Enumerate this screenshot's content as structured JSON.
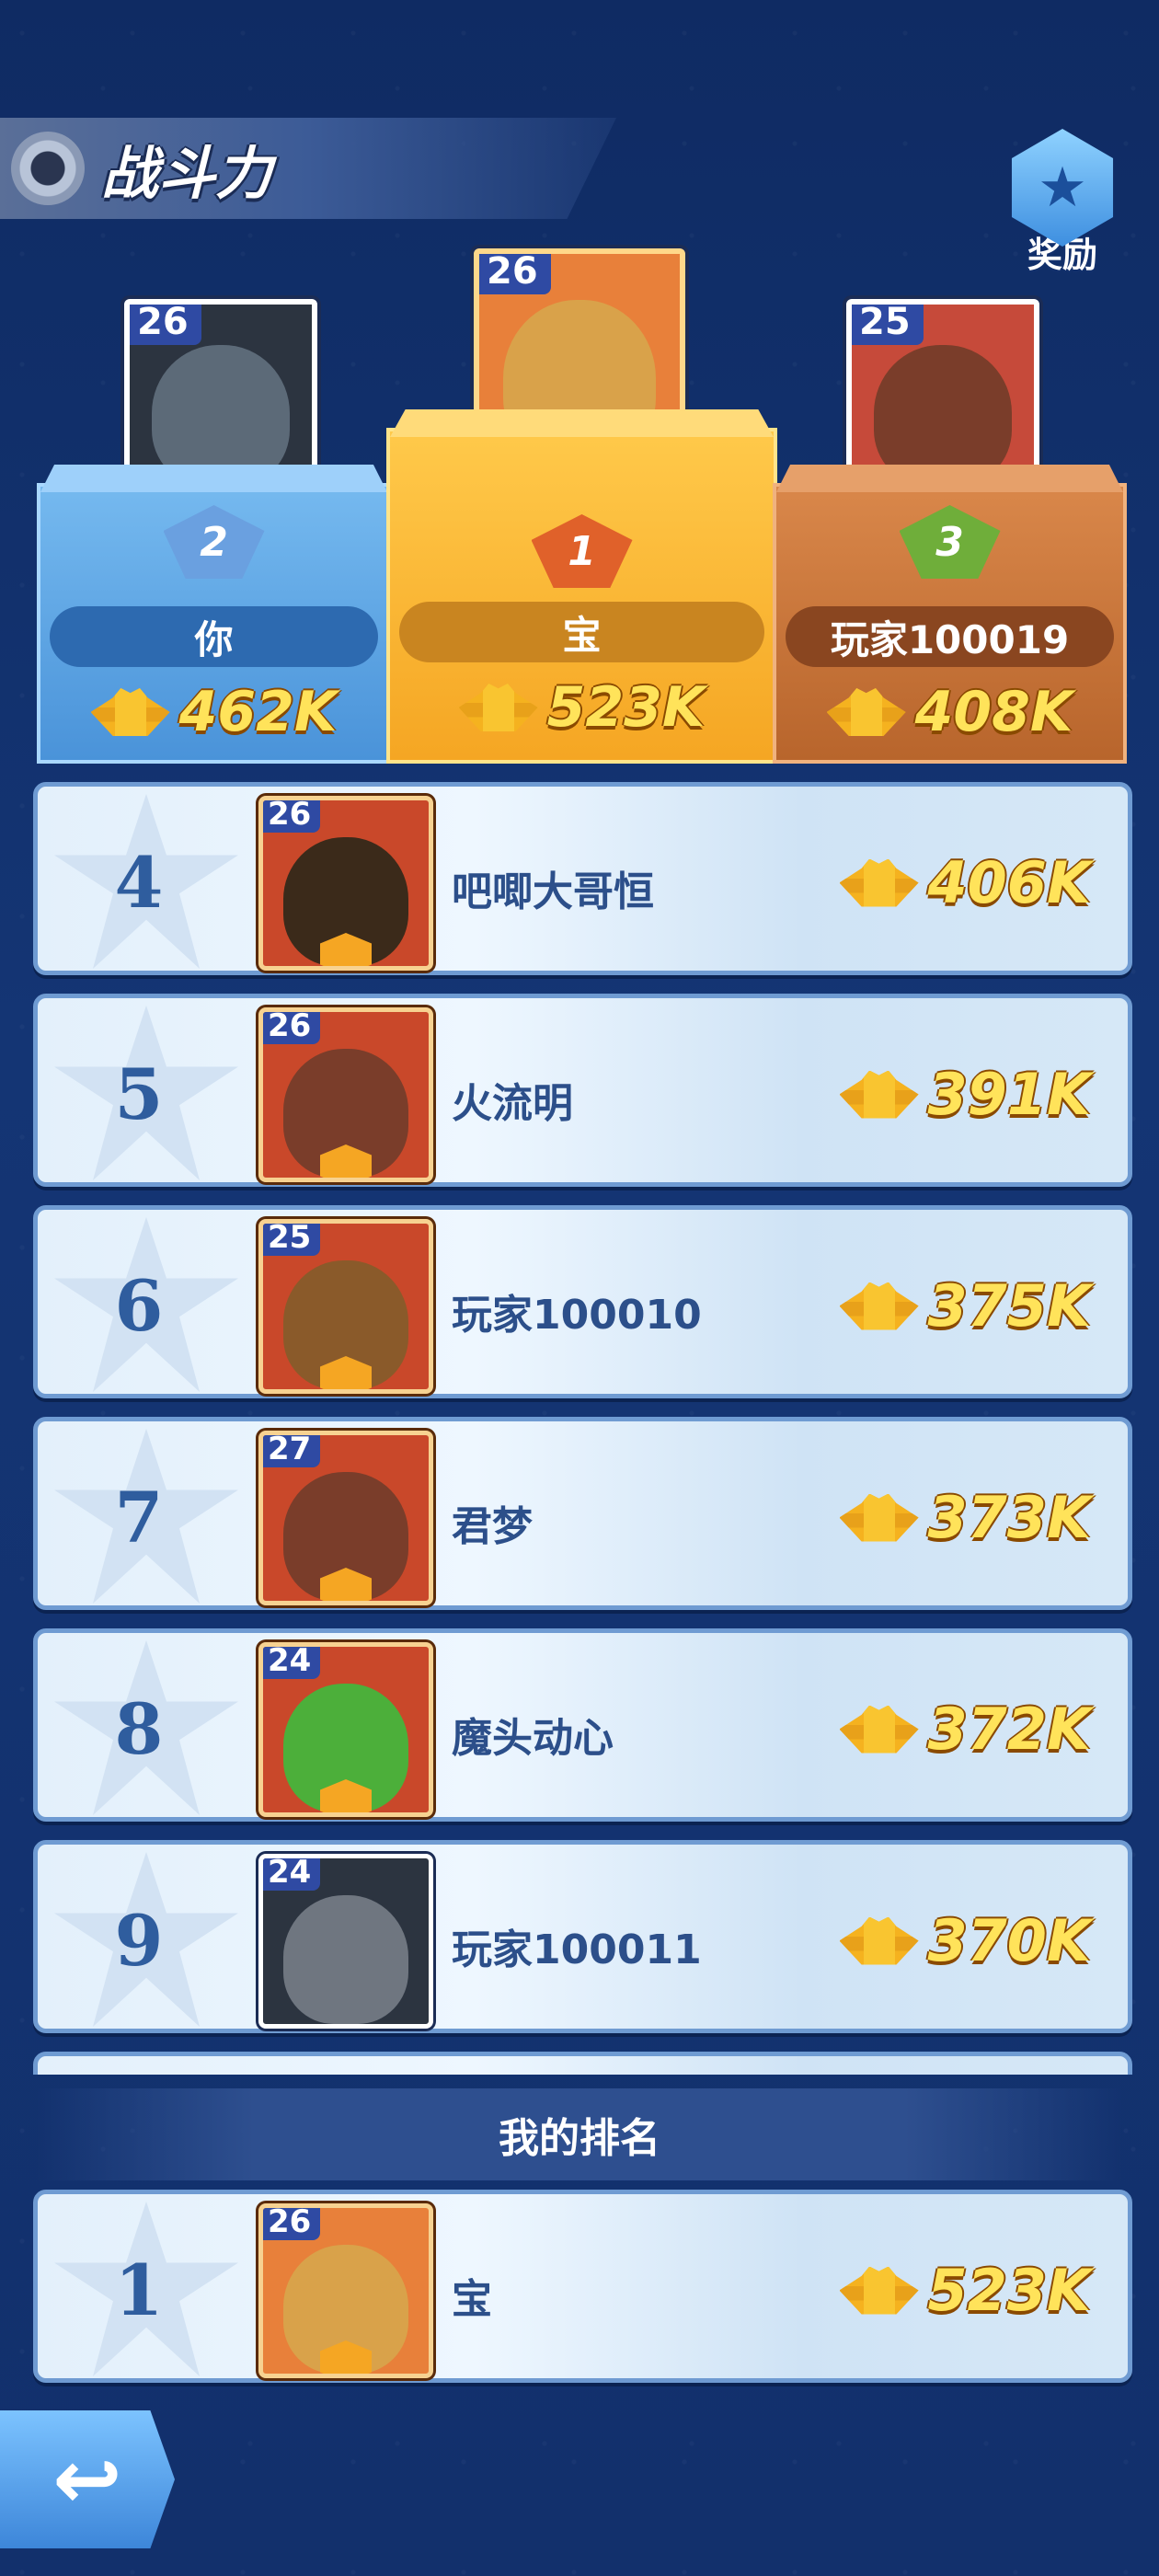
{
  "header": {
    "title": "战斗力",
    "reward_label": "奖励"
  },
  "podium": [
    {
      "place": "2",
      "level": "26",
      "name": "你",
      "power": "462K",
      "face_color": "#5c6a78"
    },
    {
      "place": "1",
      "level": "26",
      "name": "宝",
      "power": "523K",
      "face_color": "#d9a24a"
    },
    {
      "place": "3",
      "level": "25",
      "name": "玩家100019",
      "power": "408K",
      "face_color": "#7a3d2a"
    }
  ],
  "ranking": [
    {
      "rank": "4",
      "level": "26",
      "name": "吧唧大哥恒",
      "power": "406K",
      "face_color": "#3b2a1a"
    },
    {
      "rank": "5",
      "level": "26",
      "name": "火流明",
      "power": "391K",
      "face_color": "#7a3d2a"
    },
    {
      "rank": "6",
      "level": "25",
      "name": "玩家100010",
      "power": "375K",
      "face_color": "#8a5a2a"
    },
    {
      "rank": "7",
      "level": "27",
      "name": "君梦",
      "power": "373K",
      "face_color": "#7a3d2a"
    },
    {
      "rank": "8",
      "level": "24",
      "name": "魔头动心",
      "power": "372K",
      "face_color": "#4caf3a"
    },
    {
      "rank": "9",
      "level": "24",
      "name": "玩家100011",
      "power": "370K",
      "face_color": "#6f7680"
    }
  ],
  "my_rank": {
    "header": "我的排名",
    "rank": "1",
    "level": "26",
    "name": "宝",
    "power": "523K",
    "face_color": "#d9a24a"
  },
  "back_icon": "return-arrow-icon"
}
